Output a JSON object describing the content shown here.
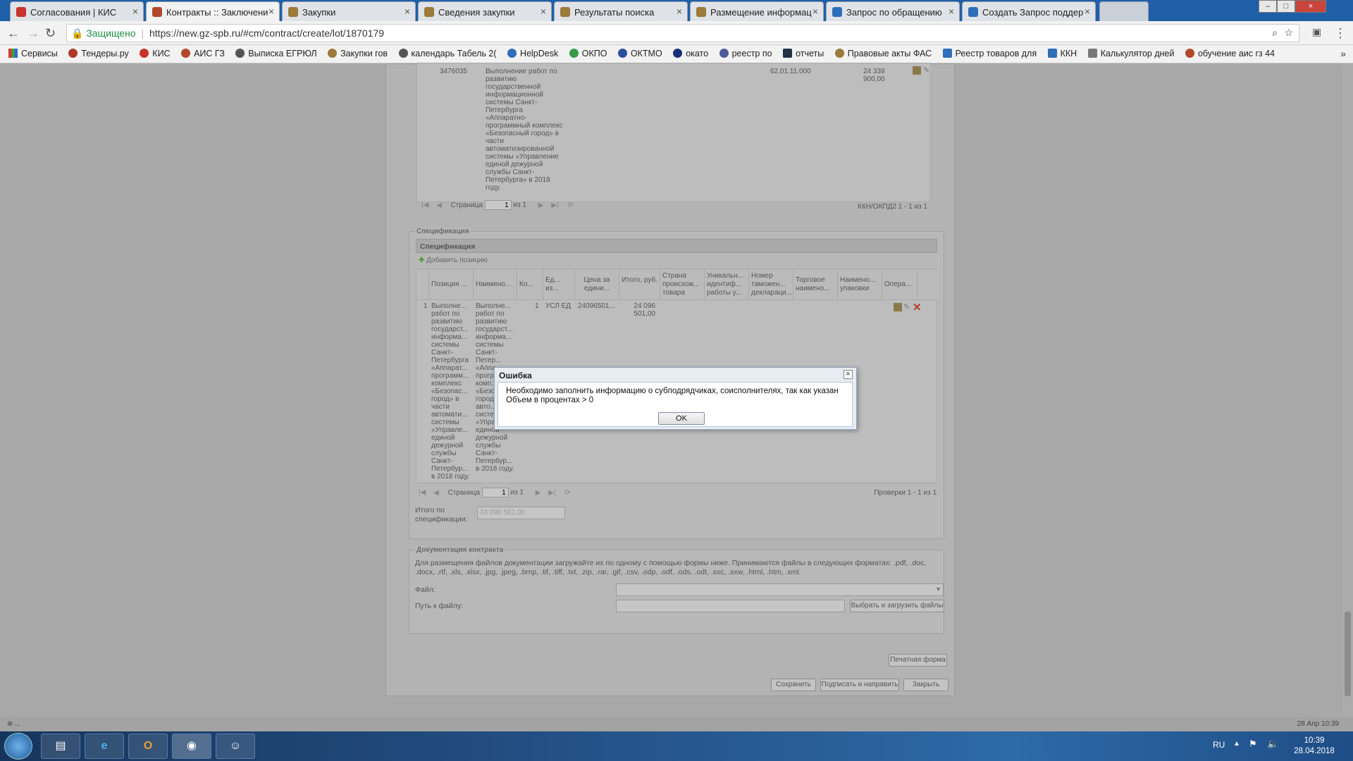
{
  "browser": {
    "tabs": [
      {
        "label": "Согласования | КИС",
        "color": "#c8322a"
      },
      {
        "label": "Контракты :: Заключени",
        "color": "#b04a2a"
      },
      {
        "label": "Закупки",
        "color": "#9b7a3a"
      },
      {
        "label": "Сведения закупки",
        "color": "#9b7a3a"
      },
      {
        "label": "Результаты поиска",
        "color": "#9b7a3a"
      },
      {
        "label": "Размещение информац",
        "color": "#9b7a3a"
      },
      {
        "label": "Запрос по обращению",
        "color": "#2d6fb8"
      },
      {
        "label": "Создать Запрос поддер",
        "color": "#2d6fb8"
      }
    ],
    "secure_label": "Защищено",
    "url": "https://new.gz-spb.ru/#cm/contract/create/lot/1870179",
    "bookmarks": [
      "Сервисы",
      "Тендеры.ру",
      "КИС",
      "АИС ГЗ",
      "Выписка ЕГРЮЛ",
      "Закупки гов",
      "календарь Табель 2(",
      "HelpDesk",
      "ОКПО",
      "ОКТМО",
      "окато",
      "реестр по",
      "отчеты",
      "Правовые акты ФАС",
      "Реестр товаров для",
      "ККН",
      "Калькулятор дней",
      "обучение аис гз 44"
    ]
  },
  "top_table": {
    "row_id": "3476035",
    "row_text": "Выполнение работ по развитию государственной информационной системы Санкт-Петербурга «Аппаратно-программный комплекс «Безопасный город» в части автоматизированной системы «Управление единой дежурной службы Санкт-Петербурга» в 2018 году.",
    "okpd": "62.01.11.000",
    "sum": "24 339 900,00",
    "pager_page_label": "Страница",
    "pager_page_value": "1",
    "pager_of": "из 1",
    "pager_summary": "ККН/ОКПД2 1 - 1 из 1"
  },
  "spec": {
    "legend": "Спецификация",
    "title": "Спецификация",
    "add_label": "Добавить позицию",
    "columns": [
      "Позиция ...",
      "Наимено...",
      "Ко...",
      "Ед... из...",
      "Цена за едини...",
      "Итого, руб.",
      "Страна происхож... товара",
      "Уникальн... идентиф... работы у...",
      "Номер таможен... деклараци...",
      "Торговое наимено...",
      "Наимено... упаковки",
      "Опера..."
    ],
    "row": {
      "num": "1",
      "position": "Выполне... работ по развитию государст... информа... системы Санкт-Петербурга «Аппарат... программ... комплекс «Безопас... город» в части автомати... системы «Управле... единой дежурной службы Санкт-Петербур... в 2018 году.",
      "name": "Выполне... работ по развитию государст... информа... системы Санкт-Петер... «Аппа... прогр... комп... «Безо... город части авто... систе... «Управле... единой дежурной службы Санкт-Петербур... в 2018 году.",
      "qty": "1",
      "unit": "УСЛ ЕД",
      "price": "24096501...",
      "total": "24 096 501,00"
    },
    "pager_page_label": "Страница",
    "pager_page_value": "1",
    "pager_of": "из 1",
    "pager_summary": "Проверки 1 - 1 из 1",
    "total_label": "Итого по спецификации:",
    "total_value": "24 096 501,00"
  },
  "docs": {
    "legend": "Документация контракта",
    "description": "Для размещения файлов документации загружайте их по одному с помощью формы ниже. Принимаются файлы в следующих форматах: .pdf, .doc, .docx, .rtf, .xls, .xlsx, .jpg, .jpeg, .bmp, .tif, .tiff, .txt, .zip, .rar, .gif, .csv, .odp, .odf, .ods, .odt, .sxc, .sxw, .html, .htm, .xml.",
    "file_label": "Файл:",
    "path_label": "Путь к файлу:",
    "upload_label": "Выбрать и загрузить файлы"
  },
  "actions": {
    "print": "Печатная форма",
    "save": "Сохранить",
    "sign_send": "Подписать и направить",
    "close": "Закрыть"
  },
  "dialog": {
    "title": "Ошибка",
    "message": "Необходимо заполнить информацию о субподрядчиках, соисполнителях, так как указан Объем в процентах > 0",
    "ok": "OK"
  },
  "status": {
    "left": "⊕ ...",
    "right": "28 Апр 10:39"
  },
  "taskbar": {
    "lang": "RU",
    "time": "10:39",
    "date": "28.04.2018"
  }
}
